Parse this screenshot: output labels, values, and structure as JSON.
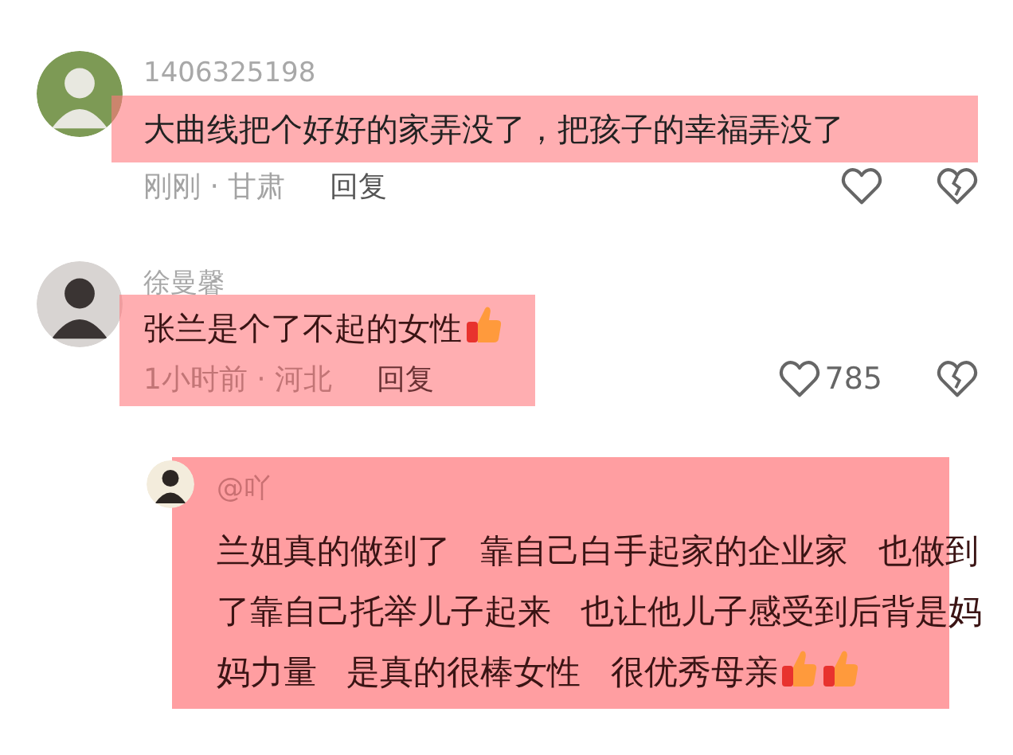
{
  "comments": [
    {
      "kind": "line",
      "username": "1406325198",
      "text": "大曲线把个好好的家弄没了，把孩子的幸福弄没了",
      "time_location": "刚刚 · 甘肃",
      "reply_label": "回复"
    },
    {
      "kind": "block",
      "username": "徐曼馨",
      "text": "张兰是个了不起的女性",
      "emojis": [
        {
          "kind": "thumbs-up"
        }
      ],
      "time_location": "1小时前 · 河北",
      "reply_label": "回复",
      "like_count": "785"
    },
    {
      "kind": "reply",
      "username": "@吖",
      "text": "兰姐真的做到了 靠自己白手起家的企业家 也做到了靠自己托举儿子起来 也让他儿子感受到后背是妈妈力量 是真的很棒女性 很优秀母亲",
      "emojis": [
        {
          "kind": "thumbs-up"
        },
        {
          "kind": "thumbs-up"
        }
      ]
    }
  ]
}
